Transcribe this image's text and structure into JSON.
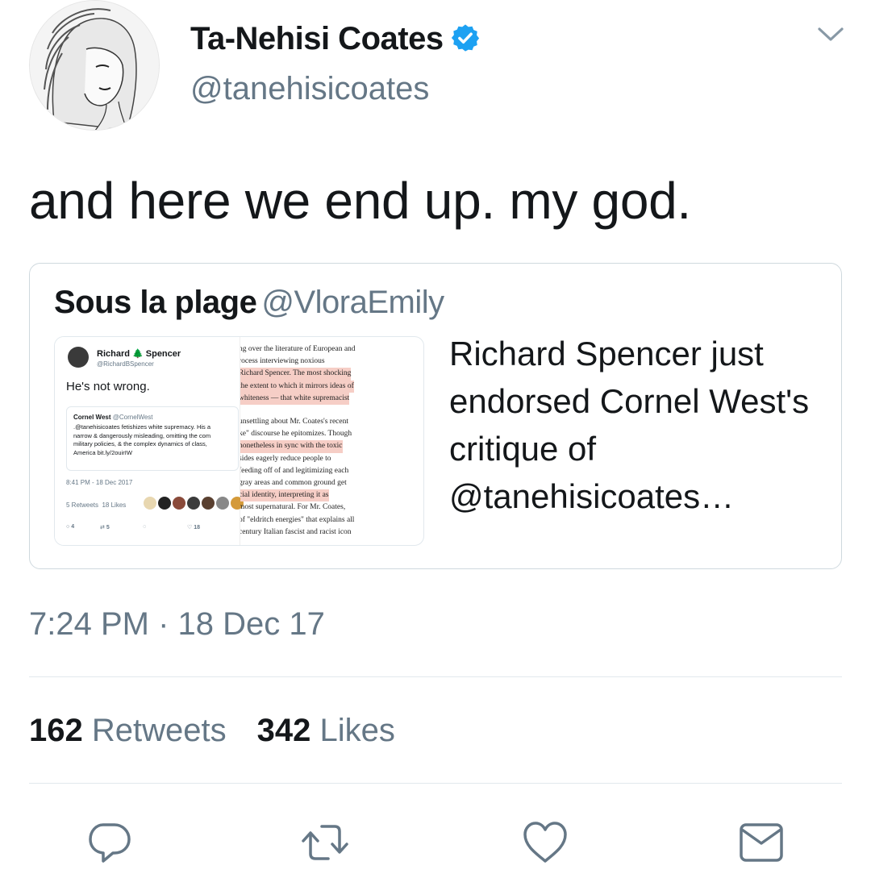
{
  "author": {
    "display_name": "Ta-Nehisi Coates",
    "handle": "@tanehisicoates",
    "verified": true
  },
  "tweet": {
    "text": "and here we end up. my god.",
    "timestamp": "7:24 PM · 18 Dec 17"
  },
  "quoted_tweet": {
    "display_name": "Sous la plage",
    "handle": "@VloraEmily",
    "text": "Richard Spencer just endorsed Cornel West's critique of @tanehisicoates…",
    "media": {
      "embedded_tweet": {
        "name": "Richard 🌲 Spencer",
        "handle": "@RichardBSpencer",
        "text": "He's not wrong.",
        "quoted": {
          "name": "Cornel West",
          "handle": "@CornelWest",
          "lines": [
            ".@tanehisicoates fetishizes white supremacy. His a",
            "narrow & dangerously misleading, omitting the com",
            "military policies, & the complex dynamics of class,",
            "America bit.ly/2ouirIW"
          ]
        },
        "time": "8:41 PM - 18 Dec 2017",
        "retweets_label": "5 Retweets",
        "likes_label": "18 Likes",
        "actions": {
          "reply": "4",
          "retweet": "5",
          "like": "18"
        }
      },
      "article_lines": [
        {
          "text": "ng over the literature of European and",
          "highlight": false
        },
        {
          "text": "rocess interviewing noxious",
          "highlight": false
        },
        {
          "text": "Richard Spencer. The most shocking",
          "highlight": true
        },
        {
          "text": "the extent to which it mirrors ideas of",
          "highlight": true
        },
        {
          "text": "whiteness — that white supremacist",
          "highlight": true
        },
        {
          "text": "",
          "highlight": false
        },
        {
          "text": "unsettling about Mr. Coates's recent",
          "highlight": false
        },
        {
          "text": "ke\" discourse he epitomizes. Though",
          "highlight": false
        },
        {
          "text": "nonetheless in sync with the toxic",
          "highlight": true
        },
        {
          "text": "sides eagerly reduce people to",
          "highlight": false
        },
        {
          "text": "feeding off of and legitimizing each",
          "highlight": false
        },
        {
          "text": "gray areas and common ground get",
          "highlight": false
        },
        {
          "text": "cial identity, interpreting it as",
          "highlight": true
        },
        {
          "text": "most supernatural. For Mr. Coates,",
          "highlight": false
        },
        {
          "text": "of \"eldritch energies\" that explains all",
          "highlight": false
        },
        {
          "text": "century Italian fascist and racist icon",
          "highlight": false
        }
      ]
    }
  },
  "stats": {
    "retweets_count": "162",
    "retweets_label": "Retweets",
    "likes_count": "342",
    "likes_label": "Likes"
  },
  "actions": [
    "reply-icon",
    "retweet-icon",
    "like-icon",
    "message-icon"
  ],
  "colors": {
    "text": "#14171a",
    "secondary": "#657786",
    "verified": "#1da1f2",
    "border": "#cfd9de",
    "highlight": "#f6cec6"
  }
}
